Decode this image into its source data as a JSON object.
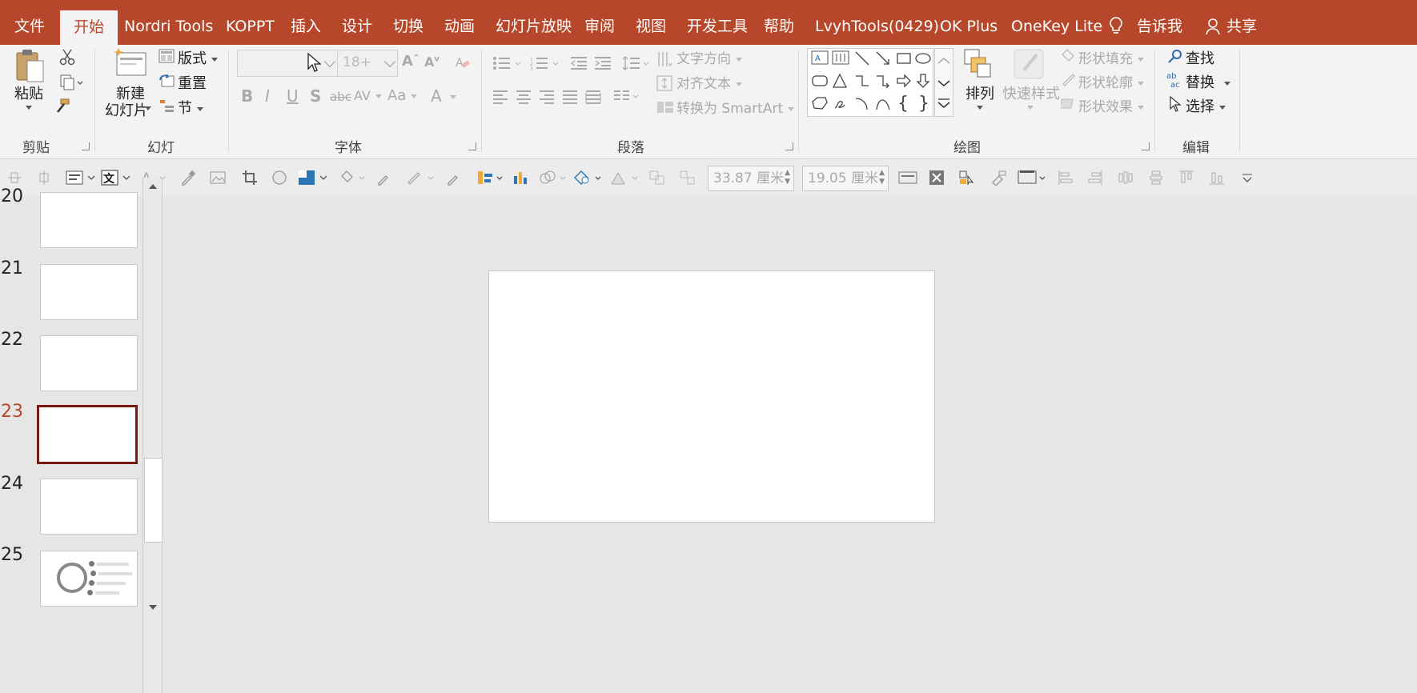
{
  "tabs": [
    {
      "id": "file",
      "label": "文件"
    },
    {
      "id": "home",
      "label": "开始",
      "active": true
    },
    {
      "id": "nordri",
      "label": "Nordri Tools"
    },
    {
      "id": "koppt",
      "label": "KOPPT"
    },
    {
      "id": "insert",
      "label": "插入"
    },
    {
      "id": "design",
      "label": "设计"
    },
    {
      "id": "transitions",
      "label": "切换"
    },
    {
      "id": "animations",
      "label": "动画"
    },
    {
      "id": "slideshow",
      "label": "幻灯片放映"
    },
    {
      "id": "review",
      "label": "审阅"
    },
    {
      "id": "view",
      "label": "视图"
    },
    {
      "id": "developer",
      "label": "开发工具"
    },
    {
      "id": "help",
      "label": "帮助"
    },
    {
      "id": "lvyh",
      "label": "LvyhTools(0429)"
    },
    {
      "id": "okplus",
      "label": "OK Plus"
    },
    {
      "id": "onekey",
      "label": "OneKey Lite"
    }
  ],
  "tellme": "告诉我",
  "share": "共享",
  "ribbon": {
    "clipboard": {
      "label": "剪贴板",
      "paste": "粘贴"
    },
    "slides": {
      "label": "幻灯片",
      "new_slide_line1": "新建",
      "new_slide_line2": "幻灯片",
      "layout": "版式",
      "reset": "重置",
      "section": "节"
    },
    "font": {
      "label": "字体",
      "font_name": "",
      "font_size": "18+",
      "bold": "B",
      "italic": "I",
      "underline": "U",
      "shadow": "S",
      "strike": "abc",
      "spacing": "AV",
      "case": "Aa",
      "color": "A"
    },
    "paragraph": {
      "label": "段落",
      "text_direction": "文字方向",
      "align_text": "对齐文本",
      "convert_smartart": "转换为 SmartArt"
    },
    "drawing": {
      "label": "绘图",
      "arrange": "排列",
      "quick_styles": "快速样式",
      "shape_fill": "形状填充",
      "shape_outline": "形状轮廓",
      "shape_effects": "形状效果"
    },
    "editing": {
      "label": "编辑",
      "find": "查找",
      "replace": "替换",
      "select": "选择"
    }
  },
  "quickbar": {
    "width_value": "33.87 厘米",
    "height_value": "19.05 厘米"
  },
  "slides": [
    {
      "num": "20"
    },
    {
      "num": "21"
    },
    {
      "num": "22"
    },
    {
      "num": "23",
      "selected": true
    },
    {
      "num": "24"
    },
    {
      "num": "25",
      "has_content": true
    }
  ],
  "colors": {
    "accent": "#b7472a",
    "selected_border": "#7a1b12",
    "background": "#e6e6e6"
  }
}
